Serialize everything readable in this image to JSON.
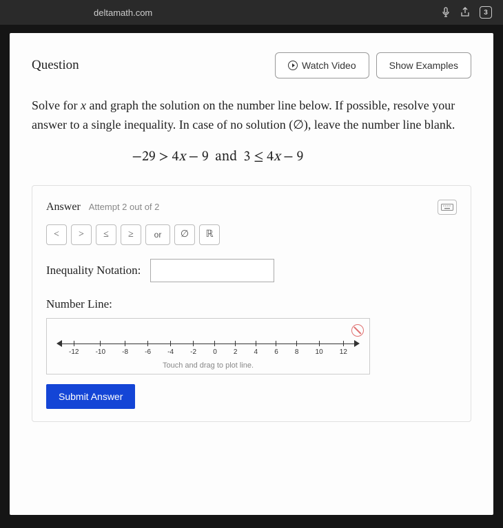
{
  "browser": {
    "url": "deltamath.com",
    "tab_count": "3"
  },
  "header": {
    "question_label": "Question",
    "watch_video": "Watch Video",
    "show_examples": "Show Examples"
  },
  "prompt": {
    "line1_a": "Solve for ",
    "line1_var": "x",
    "line1_b": " and graph the solution on the number line below. If possible, resolve your answer to a single inequality. In case of no solution (∅), leave the number line blank."
  },
  "equation": "−29 > 4x − 9   and   3 ≤ 4x − 9",
  "answer": {
    "title": "Answer",
    "attempt": "Attempt 2 out of 2",
    "symbols": [
      "<",
      ">",
      "≤",
      "≥",
      "or",
      "∅",
      "ℝ"
    ],
    "notation_label": "Inequality Notation:",
    "notation_value": "",
    "numberline_label": "Number Line:",
    "numberline_hint": "Touch and drag to plot line.",
    "submit": "Submit Answer"
  },
  "numberline": {
    "ticks": [
      -12,
      -10,
      -8,
      -6,
      -4,
      -2,
      0,
      2,
      4,
      6,
      8,
      10,
      12
    ]
  }
}
